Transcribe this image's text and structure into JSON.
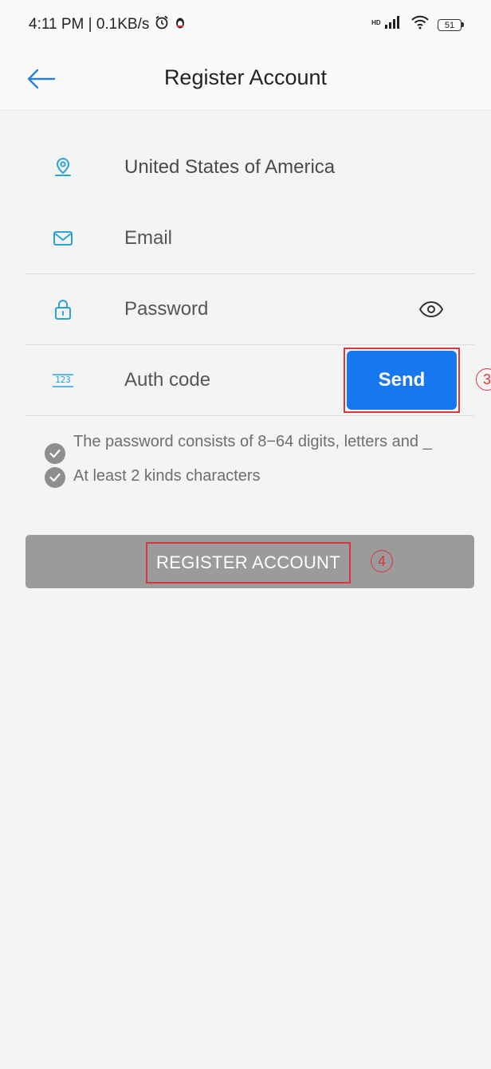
{
  "status_bar": {
    "time_speed": "4:11 PM | 0.1KB/s",
    "battery": "51"
  },
  "header": {
    "title": "Register Account"
  },
  "form": {
    "country": "United States of America",
    "email_placeholder": "Email",
    "password_placeholder": "Password",
    "auth_code_placeholder": "Auth code",
    "send_label": "Send"
  },
  "rules": {
    "rule1": "The password consists of 8−64 digits, letters and _",
    "rule2": "At least 2 kinds characters"
  },
  "register_label": "REGISTER ACCOUNT",
  "annotations": {
    "step3": "3",
    "step4": "4"
  },
  "colors": {
    "accent": "#1677ee",
    "icon": "#2aa3d6",
    "annotation": "#d9363e",
    "disabled_button": "#9b9b9b"
  }
}
